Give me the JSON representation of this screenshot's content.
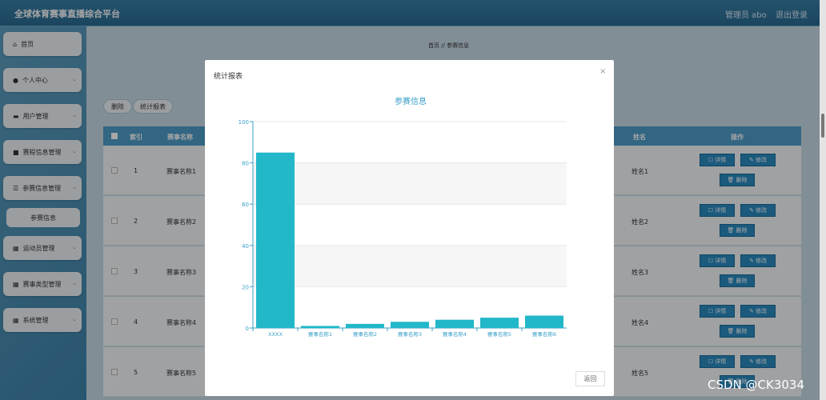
{
  "header": {
    "title": "全球体育赛事直播综合平台",
    "admin": "管理员 abo",
    "logout": "退出登录"
  },
  "sidebar": {
    "items": [
      {
        "label": "首页",
        "icon": "home-icon"
      },
      {
        "label": "个人中心",
        "icon": "user-icon"
      },
      {
        "label": "用户管理",
        "icon": "bank-icon"
      },
      {
        "label": "赛程信息管理",
        "icon": "square-icon"
      },
      {
        "label": "参赛信息管理",
        "icon": "list-icon"
      },
      {
        "label": "运动员管理",
        "icon": "grid-icon"
      },
      {
        "label": "赛事类型管理",
        "icon": "grid-icon"
      },
      {
        "label": "系统管理",
        "icon": "grid-icon"
      }
    ],
    "submenu": "参赛信息"
  },
  "breadcrumb": "首页 // 参赛信息",
  "actions": {
    "delete": "删除",
    "report": "统计报表"
  },
  "table": {
    "headers": {
      "index": "索引",
      "event": "赛事名称",
      "name": "姓名",
      "ops": "操作"
    },
    "rows": [
      {
        "index": "1",
        "event": "赛事名称1",
        "name": "姓名1"
      },
      {
        "index": "2",
        "event": "赛事名称2",
        "name": "姓名2"
      },
      {
        "index": "3",
        "event": "赛事名称3",
        "name": "姓名3"
      },
      {
        "index": "4",
        "event": "赛事名称4",
        "name": "姓名4"
      },
      {
        "index": "5",
        "event": "赛事名称5",
        "name": "姓名5"
      }
    ],
    "btn_detail": "☐ 详情",
    "btn_edit": "✎ 修改",
    "btn_delete": "🗑 删除"
  },
  "modal": {
    "title": "统计报表",
    "close": "×",
    "return": "返回"
  },
  "chart_data": {
    "type": "bar",
    "title": "参赛信息",
    "categories": [
      "XXXX",
      "赛事名称1",
      "赛事名称2",
      "赛事名称3",
      "赛事名称4",
      "赛事名称5",
      "赛事名称6"
    ],
    "values": [
      85,
      1,
      2,
      3,
      4,
      5,
      6
    ],
    "ylim": [
      0,
      100
    ],
    "yticks": [
      0,
      20,
      40,
      60,
      80,
      100
    ],
    "bar_color": "#22b7c9",
    "axis_color": "#3aa0c9",
    "grid": true
  },
  "watermark": "CSDN @CK3034"
}
